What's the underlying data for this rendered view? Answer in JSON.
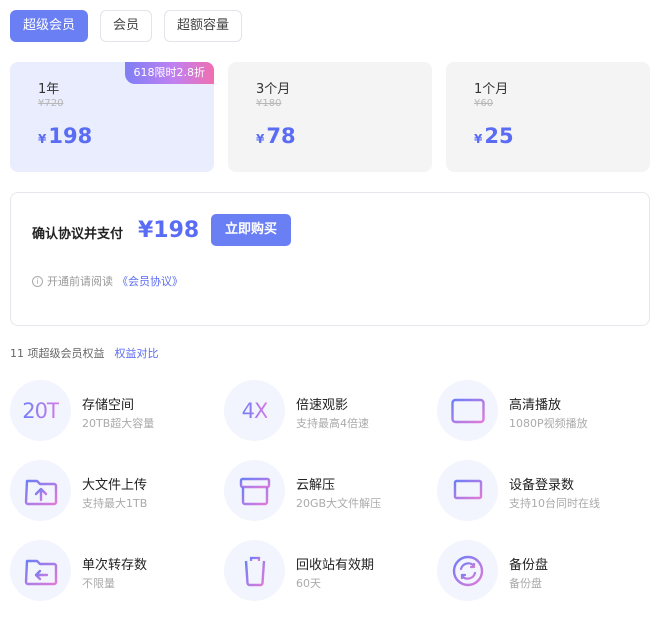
{
  "tabs": [
    {
      "label": "超级会员",
      "active": true
    },
    {
      "label": "会员",
      "active": false
    },
    {
      "label": "超额容量",
      "active": false
    }
  ],
  "plans": [
    {
      "name": "1年",
      "original": "¥720",
      "currency": "¥",
      "price": "198",
      "badge": "618限时2.8折",
      "selected": true
    },
    {
      "name": "3个月",
      "original": "¥180",
      "currency": "¥",
      "price": "78",
      "selected": false
    },
    {
      "name": "1个月",
      "original": "¥60",
      "currency": "¥",
      "price": "25",
      "selected": false
    }
  ],
  "pay": {
    "label": "确认协议并支付",
    "amount": "¥198",
    "buy_label": "立即购买",
    "agree_prefix": "开通前请阅读",
    "agree_link": "《会员协议》"
  },
  "benefits": {
    "count_label": "11 项超级会员权益",
    "compare_label": "权益对比",
    "items": [
      {
        "title": "存储空间",
        "desc": "20TB超大容量",
        "icon": "storage-20t-icon",
        "icon_text": "20T"
      },
      {
        "title": "倍速观影",
        "desc": "支持最高4倍速",
        "icon": "speed-4x-icon",
        "icon_text": "4X"
      },
      {
        "title": "高清播放",
        "desc": "1080P视频播放",
        "icon": "hd-play-icon"
      },
      {
        "title": "大文件上传",
        "desc": "支持最大1TB",
        "icon": "upload-folder-icon"
      },
      {
        "title": "云解压",
        "desc": "20GB大文件解压",
        "icon": "archive-box-icon"
      },
      {
        "title": "设备登录数",
        "desc": "支持10台同时在线",
        "icon": "laptop-icon"
      },
      {
        "title": "单次转存数",
        "desc": "不限量",
        "icon": "transfer-folder-icon"
      },
      {
        "title": "回收站有效期",
        "desc": "60天",
        "icon": "trash-icon"
      },
      {
        "title": "备份盘",
        "desc": "备份盘",
        "icon": "backup-sync-icon"
      }
    ]
  },
  "colors": {
    "accent": "#6b7ff5",
    "price": "#5b6cf4",
    "selected_bg": "#e9edfd",
    "plan_bg": "#f4f4f5"
  }
}
